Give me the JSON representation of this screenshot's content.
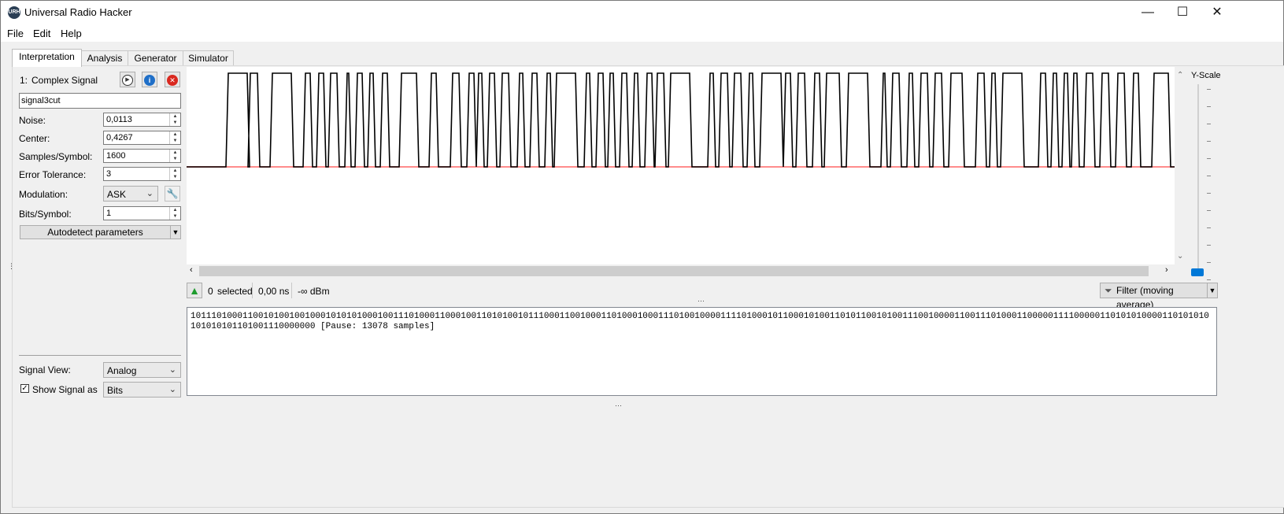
{
  "window": {
    "title": "Universal Radio Hacker",
    "icon_label": "URH",
    "controls": [
      "—",
      "☐",
      "✕"
    ]
  },
  "menu": [
    "File",
    "Edit",
    "Help"
  ],
  "tabs": [
    "Interpretation",
    "Analysis",
    "Generator",
    "Simulator"
  ],
  "signal_header": {
    "index": "1:",
    "type": "Complex Signal",
    "name": "signal3cut"
  },
  "params": [
    {
      "label": "Noise:",
      "value": "0,0113"
    },
    {
      "label": "Center:",
      "value": "0,4267"
    },
    {
      "label": "Samples/Symbol:",
      "value": "1600"
    },
    {
      "label": "Error Tolerance:",
      "value": "3"
    },
    {
      "label": "Modulation:",
      "value": "ASK"
    },
    {
      "label": "Bits/Symbol:",
      "value": "1"
    }
  ],
  "autodetect_label": "Autodetect parameters",
  "signal_view": {
    "label": "Signal View:",
    "value": "Analog"
  },
  "show_signal_as": {
    "label": "Show Signal as",
    "value": "Bits",
    "checked": true
  },
  "yscale_label": "Y-Scale",
  "status": {
    "selected_count": "0",
    "selected_label": "selected",
    "duration": "0,00 ns",
    "power": "-∞ dBm"
  },
  "filter_label": "Filter (moving average)",
  "bits_text": "1011101000110010100100100010101010001001110100011000100110101001011100011001000110100010001110100100001111010001011000101001101011001010011100100001100111010001100000111100000110101010000110101010101010101101001110000000 [Pause: 13078 samples]",
  "colors": {
    "accent": "#0078d7",
    "signal": "#000000",
    "center_line": "#ff8080"
  }
}
